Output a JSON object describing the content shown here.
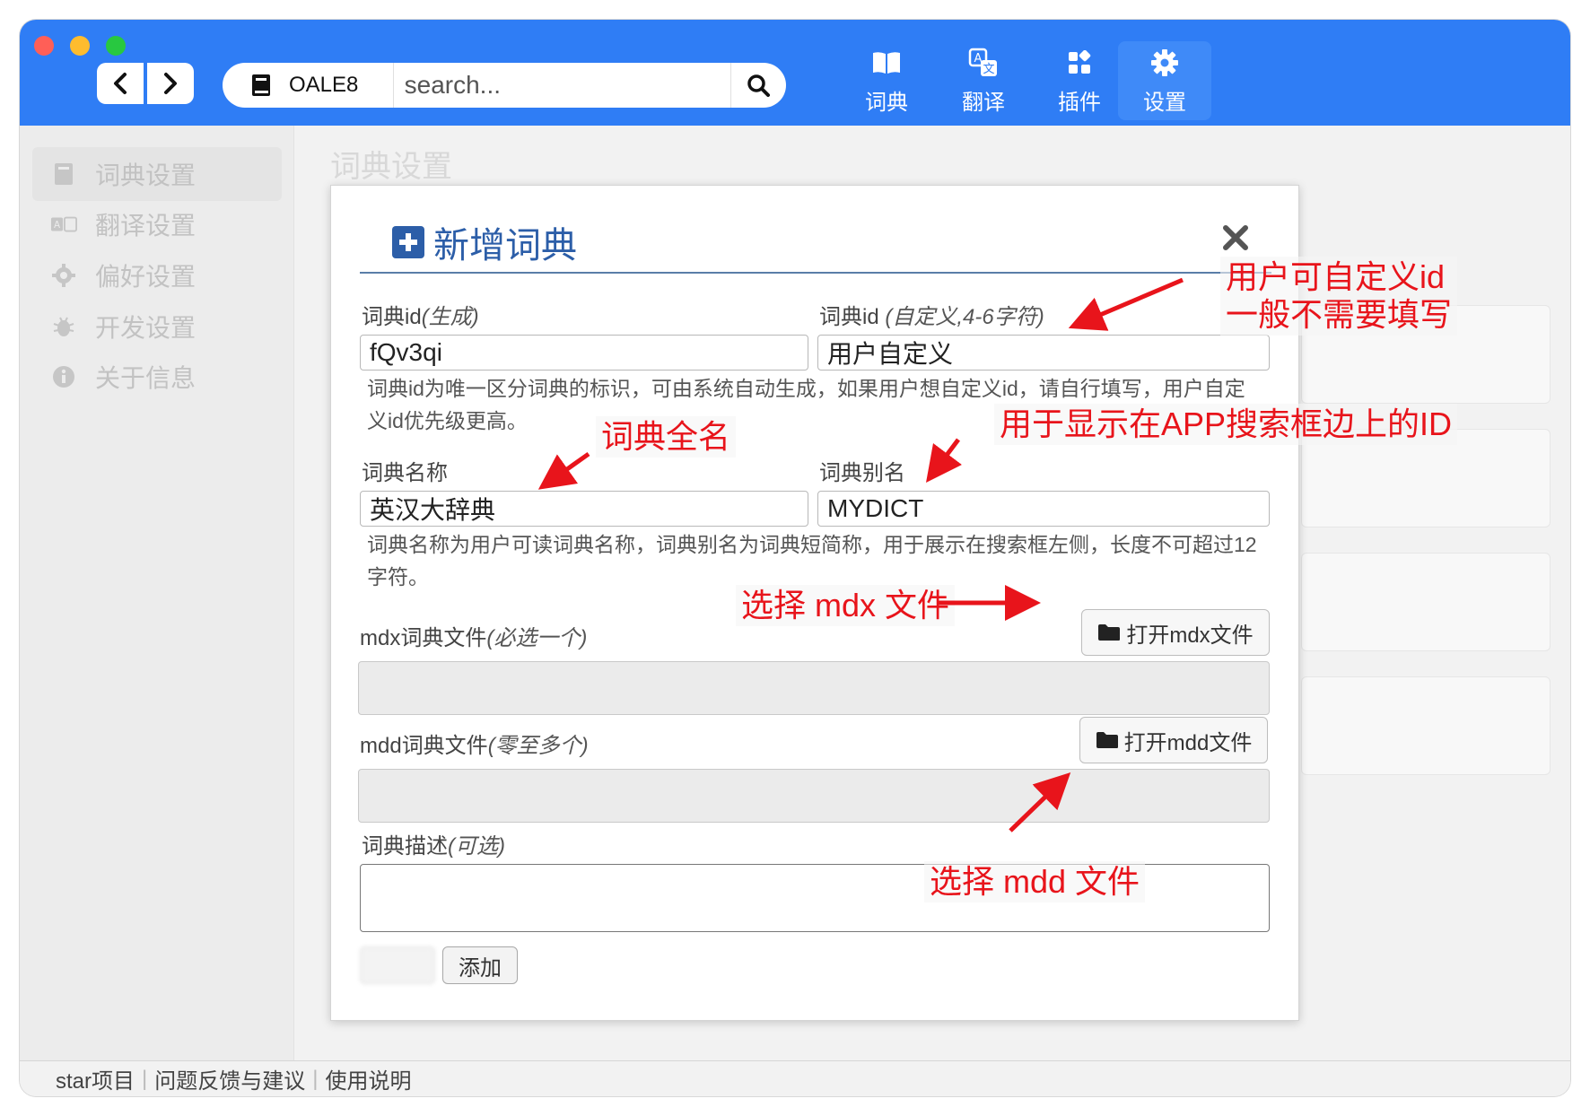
{
  "topnav": {
    "search": {
      "dict_label": "OALE8",
      "placeholder": "search..."
    },
    "tabs": [
      {
        "label": "词典",
        "icon": "book-open-icon"
      },
      {
        "label": "翻译",
        "icon": "translate-icon"
      },
      {
        "label": "插件",
        "icon": "puzzle-icon"
      },
      {
        "label": "设置",
        "icon": "gear-icon",
        "active": true
      }
    ],
    "accent": "#2f7df5"
  },
  "sidebar": {
    "items": [
      {
        "label": "词典设置",
        "icon": "book-icon",
        "active": true
      },
      {
        "label": "翻译设置",
        "icon": "translate-icon"
      },
      {
        "label": "偏好设置",
        "icon": "gear-icon"
      },
      {
        "label": "开发设置",
        "icon": "bug-icon"
      },
      {
        "label": "关于信息",
        "icon": "info-icon"
      }
    ]
  },
  "content": {
    "title": "词典设置"
  },
  "modal": {
    "title": "新增词典",
    "id_gen": {
      "label": "词典id",
      "hint": "(生成)",
      "value": "fQv3qi"
    },
    "id_custom": {
      "label": "词典id ",
      "hint": "(自定义,4-6字符)",
      "value": "用户自定义"
    },
    "id_help": "词典id为唯一区分词典的标识，可由系统自动生成，如果用户想自定义id，请自行填写，用户自定义id优先级更高。",
    "name": {
      "label": "词典名称",
      "value": "英汉大辞典"
    },
    "alias": {
      "label": "词典别名",
      "value": "MYDICT"
    },
    "name_help": "词典名称为用户可读词典名称，词典别名为词典短简称，用于展示在搜索框左侧，长度不可超过12字符。",
    "mdx": {
      "label": "mdx词典文件",
      "hint": "(必选一个)",
      "button": "打开mdx文件"
    },
    "mdd": {
      "label": "mdd词典文件",
      "hint": "(零至多个)",
      "button": "打开mdd文件"
    },
    "desc": {
      "label": "词典描述",
      "hint": "(可选)"
    },
    "add_button": "添加"
  },
  "annotations": {
    "custom_id": "用户可自定义id\n一般不需要填写",
    "full_name": "词典全名",
    "alias_note": "用于显示在APP搜索框边上的ID",
    "select_mdx": "选择 mdx 文件",
    "select_mdd": "选择 mdd 文件",
    "color": "#e8141b"
  },
  "footer": {
    "links": [
      "star项目",
      "问题反馈与建议",
      "使用说明"
    ]
  }
}
